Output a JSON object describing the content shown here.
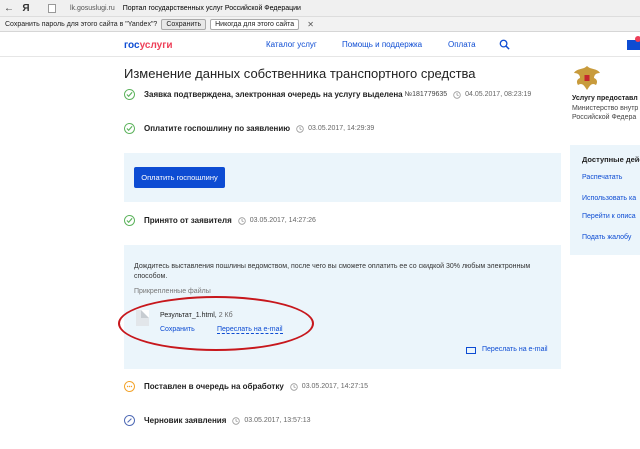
{
  "browser": {
    "back_icon": "back-arrow-icon",
    "yandex_glyph": "Я",
    "host": "lk.gosuslugi.ru",
    "tab_title": "Портал государственных услуг Российской Федерации"
  },
  "password_bar": {
    "question": "Сохранить пароль для этого сайта в \"Yandex\"?",
    "save_label": "Сохранить",
    "never_label": "Никогда для этого сайта",
    "close_glyph": "✕"
  },
  "header": {
    "logo_gos": "гос",
    "logo_usl": "услуги",
    "nav": [
      "Каталог услуг",
      "Помощь и поддержка",
      "Оплата"
    ],
    "accent": "#0d4cd3",
    "brand_red": "#ee3f58"
  },
  "page": {
    "title": "Изменение данных собственника транспортного средства"
  },
  "steps": {
    "s1": {
      "text": "Заявка подтверждена, электронная очередь на услугу выделена",
      "number": "№181779635",
      "datetime": "04.05.2017, 08:23:19"
    },
    "s2": {
      "text": "Оплатите госпошлину по заявлению",
      "datetime": "03.05.2017, 14:29:39"
    },
    "s3": {
      "text": "Принято от заявителя",
      "datetime": "03.05.2017, 14:27:26"
    },
    "s4": {
      "text": "Поставлен в очередь на обработку",
      "datetime": "03.05.2017, 14:27:15"
    },
    "s5": {
      "text": "Черновик заявления",
      "datetime": "03.05.2017, 13:57:13"
    }
  },
  "payment": {
    "button_label": "Оплатить госпошлину"
  },
  "accepted_panel": {
    "notice": "Дождитесь выставления пошлины ведомством, после чего вы сможете оплатить ее со скидкой 30% любым электронным способом.",
    "attachments_label": "Прикрепленные файлы",
    "file_name": "Результат_1.html,",
    "file_size": "2 Кб",
    "save_link": "Сохранить",
    "email_link": "Переслать на e-mail",
    "email_link_2": "Переслать на e-mail"
  },
  "provider": {
    "title": "Услугу предоставл",
    "sub_1": "Министерство внутр",
    "sub_2": "Российской Федера"
  },
  "sidebar": {
    "title": "Доступные дейс",
    "items": [
      "Распечатать",
      "Использовать ка",
      "Перейти к описа",
      "Подать жалобу"
    ]
  }
}
